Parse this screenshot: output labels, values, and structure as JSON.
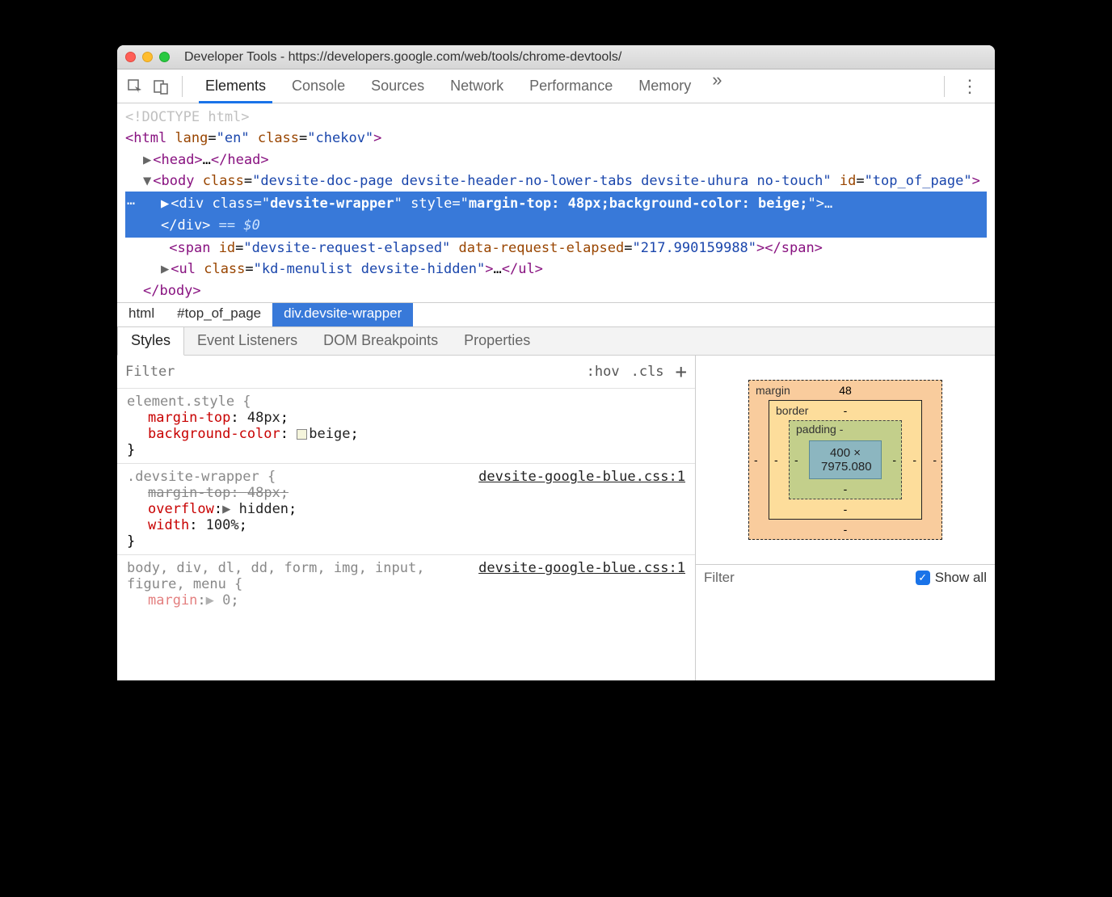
{
  "window": {
    "title": "Developer Tools - https://developers.google.com/web/tools/chrome-devtools/"
  },
  "tabs": [
    "Elements",
    "Console",
    "Sources",
    "Network",
    "Performance",
    "Memory"
  ],
  "dom": {
    "doctype": "<!DOCTYPE html>",
    "html_open": "<html lang=\"en\" class=\"chekov\">",
    "head": "<head>…</head>",
    "body_open": "<body class=\"devsite-doc-page devsite-header-no-lower-tabs devsite-uhura no-touch\" id=\"top_of_page\">",
    "selected": "<div class=\"devsite-wrapper\" style=\"margin-top: 48px;background-color: beige;\">…</div> == $0",
    "span": "<span id=\"devsite-request-elapsed\" data-request-elapsed=\"217.990159988\"></span>",
    "ul": "<ul class=\"kd-menulist devsite-hidden\">…</ul>",
    "body_close": "</body>"
  },
  "breadcrumbs": [
    "html",
    "#top_of_page",
    "div.devsite-wrapper"
  ],
  "subtabs": [
    "Styles",
    "Event Listeners",
    "DOM Breakpoints",
    "Properties"
  ],
  "styles": {
    "filter_placeholder": "Filter",
    "hov": ":hov",
    "cls": ".cls",
    "block1": {
      "selector": "element.style {",
      "p1_name": "margin-top",
      "p1_val": "48px",
      "p2_name": "background-color",
      "p2_val": "beige",
      "close": "}"
    },
    "block2": {
      "selector": ".devsite-wrapper {",
      "link": "devsite-google-blue.css:1",
      "p1_name": "margin-top",
      "p1_val": "48px",
      "p2_name": "overflow",
      "p2_val": "hidden",
      "p3_name": "width",
      "p3_val": "100%",
      "close": "}"
    },
    "block3": {
      "selector": "body, div, dl, dd, form, img, input, figure, menu {",
      "link": "devsite-google-blue.css:1",
      "p1_name": "margin",
      "p1_val": "0"
    }
  },
  "box": {
    "margin_label": "margin",
    "border_label": "border",
    "padding_label": "padding",
    "margin_top": "48",
    "dash": "-",
    "content": "400 × 7975.080"
  },
  "computed": {
    "filter": "Filter",
    "showall": "Show all"
  }
}
